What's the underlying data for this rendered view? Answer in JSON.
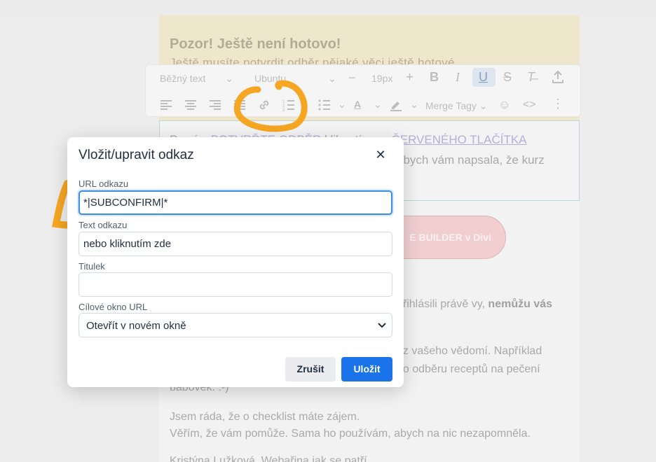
{
  "email": {
    "banner_title": "Pozor! Ještě není hotovo!",
    "banner_sub": "Ještě musíte potvrdit odběr nějaké věci ještě hotové",
    "edit_line1_pre": "Prosím ",
    "edit_line1_link1": "POTVRĎTE ODBĚR",
    "edit_line1_mid": " kliknutím na ",
    "edit_line1_link2": "ČERVENÉHO TLAČÍTKA",
    "edit_line2": "abych vám napsala, že kurz",
    "pink_button": "E BUILDER v Divi",
    "p1_right": "přihlásili právě vy, ",
    "p1_bold": "nemůžu vás",
    "p2_right": "ez vašeho vědomí. Například",
    "p3_right": "ho odběru receptů na pečení",
    "p4": "bábovek. :-)",
    "p5": "Jsem ráda, že o checklist máte zájem.",
    "p6": "Věřím, že vám pomůže. Sama ho používám, abych na nic nezapomněla.",
    "p7": "Kristýna Lužková, Webařina jak se patří"
  },
  "toolbar": {
    "format_select": "Běžný text",
    "font_select": "Ubuntu",
    "font_size": "19px",
    "merge_tags": "Merge Tagy"
  },
  "dialog": {
    "title": "Vložit/upravit odkaz",
    "url_label": "URL odkazu",
    "url_value": "*|SUBCONFIRM|*",
    "text_label": "Text odkazu",
    "text_value": "nebo kliknutím zde",
    "title_label": "Titulek",
    "title_value": "",
    "target_label": "Cílové okno URL",
    "target_value": "Otevřít v novém okně",
    "cancel_label": "Zrušit",
    "save_label": "Uložit"
  },
  "colors": {
    "accent": "#1a73e8",
    "focus": "#3b8ee0",
    "annotation": "#f5a623"
  }
}
